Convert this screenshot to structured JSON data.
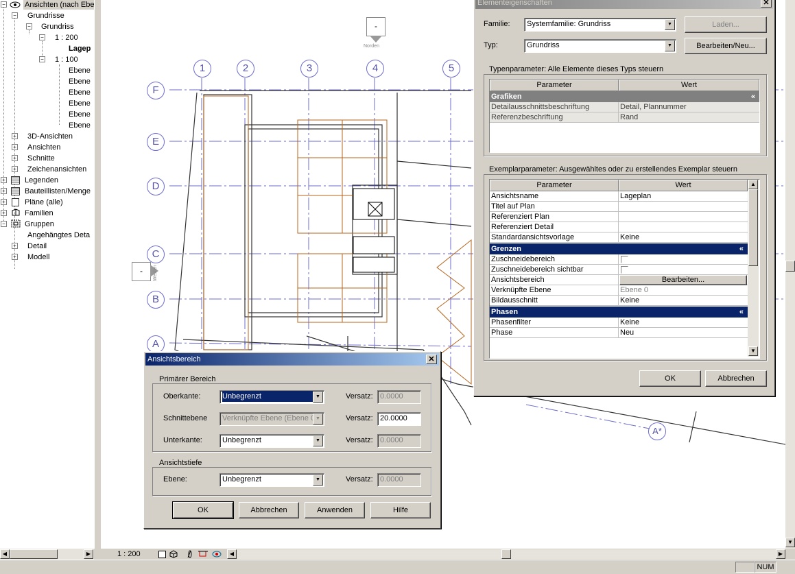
{
  "browser": {
    "items": [
      {
        "label": "Ansichten (nach Ebe"
      },
      {
        "label": "Grundrisse"
      },
      {
        "label": "Grundriss"
      },
      {
        "label": "1 : 200"
      },
      {
        "label": "Lagep"
      },
      {
        "label": "1 : 100"
      },
      {
        "label": "Ebene"
      },
      {
        "label": "Ebene"
      },
      {
        "label": "Ebene"
      },
      {
        "label": "Ebene"
      },
      {
        "label": "Ebene"
      },
      {
        "label": "Ebene"
      },
      {
        "label": "3D-Ansichten"
      },
      {
        "label": "Ansichten"
      },
      {
        "label": "Schnitte"
      },
      {
        "label": "Zeichenansichten"
      },
      {
        "label": "Legenden"
      },
      {
        "label": "Bauteillisten/Menge"
      },
      {
        "label": "Pläne (alle)"
      },
      {
        "label": "Familien"
      },
      {
        "label": "Gruppen"
      },
      {
        "label": "Angehängtes Deta"
      },
      {
        "label": "Detail"
      },
      {
        "label": "Modell"
      }
    ]
  },
  "canvas": {
    "grid_columns": [
      "1",
      "2",
      "3",
      "4",
      "5"
    ],
    "grid_rows": [
      "F",
      "E",
      "D",
      "C",
      "B",
      "A"
    ],
    "north_marker": "-",
    "north_label": "Norden",
    "west_marker": "-",
    "west_label": "Westen",
    "extra_grid": "A*"
  },
  "view_bar": {
    "scale": "1 : 200"
  },
  "status_bar": {
    "num": "NUM"
  },
  "props": {
    "title": "Elementeigenschaften",
    "familie_label": "Familie:",
    "familie_value": "Systemfamilie: Grundriss",
    "typ_label": "Typ:",
    "typ_value": "Grundriss",
    "laden_label": "Laden...",
    "bearbeiten_neu_label": "Bearbeiten/Neu...",
    "type_params_title": "Typenparameter: Alle Elemente dieses Typs steuern",
    "col_param": "Parameter",
    "col_wert": "Wert",
    "type_section": "Grafiken",
    "type_rows": [
      {
        "p": "Detailausschnittsbeschriftung",
        "w": "Detail, Plannummer"
      },
      {
        "p": "Referenzbeschriftung",
        "w": "Rand"
      }
    ],
    "inst_params_title": "Exemplarparameter: Ausgewähltes oder zu erstellendes Exemplar steuern",
    "inst_rows": [
      {
        "p": "Ansichtsname",
        "w": "Lageplan"
      },
      {
        "p": "Titel auf Plan",
        "w": ""
      },
      {
        "p": "Referenziert Plan",
        "w": ""
      },
      {
        "p": "Referenziert Detail",
        "w": ""
      },
      {
        "p": "Standardansichtsvorlage",
        "w": "Keine"
      }
    ],
    "section_grenzen": "Grenzen",
    "grenzen_rows": [
      {
        "p": "Zuschneidebereich",
        "w": ""
      },
      {
        "p": "Zuschneidebereich sichtbar",
        "w": ""
      },
      {
        "p": "Ansichtsbereich",
        "w": "Bearbeiten..."
      },
      {
        "p": "Verknüpfte Ebene",
        "w": "Ebene 0"
      },
      {
        "p": "Bildausschnitt",
        "w": "Keine"
      }
    ],
    "section_phasen": "Phasen",
    "phasen_rows": [
      {
        "p": "Phasenfilter",
        "w": "Keine"
      },
      {
        "p": "Phase",
        "w": "Neu"
      }
    ],
    "ok_label": "OK",
    "abbrechen_label": "Abbrechen",
    "collapse_glyph": "«"
  },
  "range": {
    "title": "Ansichtsbereich",
    "primary_title": "Primärer Bereich",
    "oberkante_label": "Oberkante:",
    "oberkante_value": "Unbegrenzt",
    "schnitt_label": "Schnittebene",
    "schnitt_value": "Verknüpfte Ebene (Ebene 0",
    "unterkante_label": "Unterkante:",
    "unterkante_value": "Unbegrenzt",
    "versatz_label": "Versatz:",
    "versatz_1": "0.0000",
    "versatz_2": "20.0000",
    "versatz_3": "0.0000",
    "depth_title": "Ansichtstiefe",
    "ebene_label": "Ebene:",
    "ebene_value": "Unbegrenzt",
    "versatz_4": "0.0000",
    "ok_label": "OK",
    "abbrechen_label": "Abbrechen",
    "anwenden_label": "Anwenden",
    "hilfe_label": "Hilfe"
  }
}
